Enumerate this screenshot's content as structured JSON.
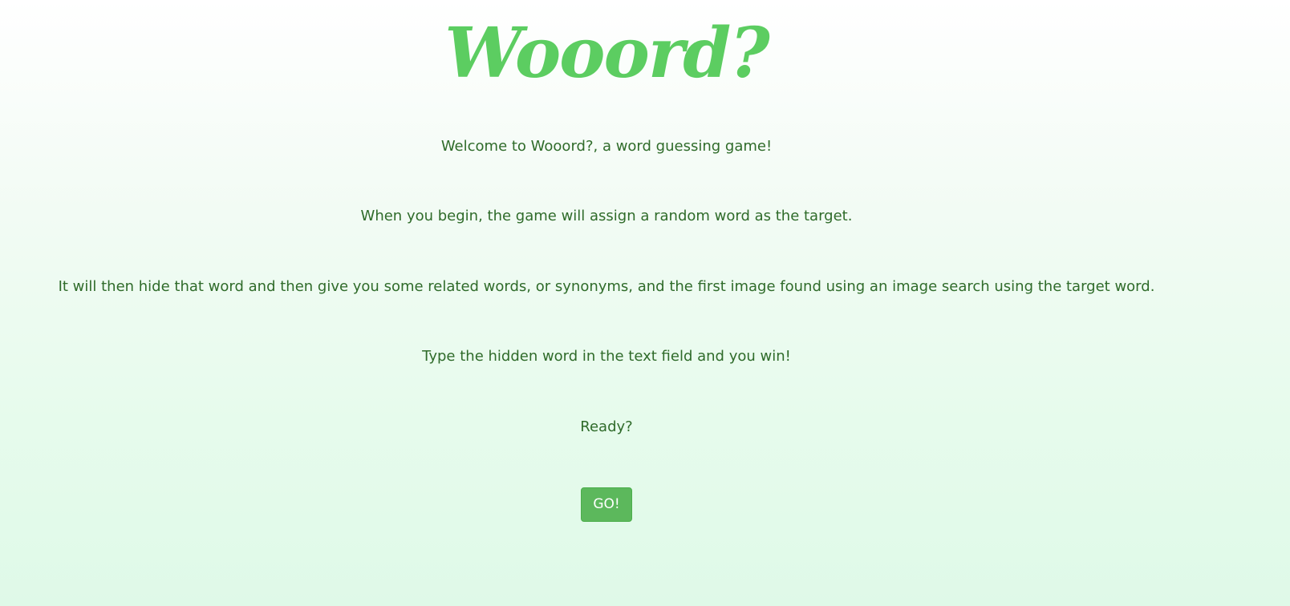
{
  "header": {
    "title": "Wooord?"
  },
  "intro": {
    "welcome": "Welcome to Wooord?, a word guessing game!",
    "begin": "When you begin, the game will assign a random word as the target.",
    "hint": "It will then hide that word and then give you some related words, or synonyms, and the first image found using an image search using the target word.",
    "instructions": "Type the hidden word in the text field and you win!",
    "ready": "Ready?"
  },
  "actions": {
    "go_label": "GO!"
  },
  "colors": {
    "title": "#5ccd61",
    "text": "#2f6b2a",
    "button": "#5cb85c"
  }
}
